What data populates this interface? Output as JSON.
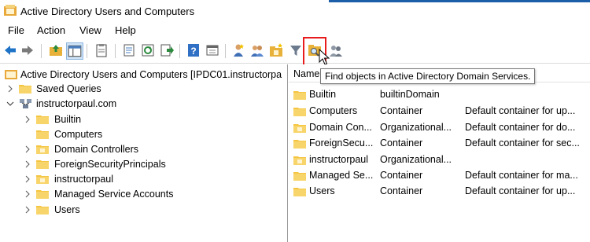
{
  "window": {
    "title": "Active Directory Users and Computers"
  },
  "menu": [
    "File",
    "Action",
    "View",
    "Help"
  ],
  "tooltip": "Find objects in Active Directory Domain Services.",
  "tree": {
    "root": "Active Directory Users and Computers [IPDC01.instructorpa",
    "saved_queries": "Saved Queries",
    "domain": "instructorpaul.com",
    "children": [
      "Builtin",
      "Computers",
      "Domain Controllers",
      "ForeignSecurityPrincipals",
      "instructorpaul",
      "Managed Service Accounts",
      "Users"
    ]
  },
  "list": {
    "header_name": "Name",
    "rows": [
      {
        "name": "Builtin",
        "type": "builtinDomain",
        "desc": ""
      },
      {
        "name": "Computers",
        "type": "Container",
        "desc": "Default container for up..."
      },
      {
        "name": "Domain Con...",
        "type": "Organizational...",
        "desc": "Default container for do..."
      },
      {
        "name": "ForeignSecu...",
        "type": "Container",
        "desc": "Default container for sec..."
      },
      {
        "name": "instructorpaul",
        "type": "Organizational...",
        "desc": ""
      },
      {
        "name": "Managed Se...",
        "type": "Container",
        "desc": "Default container for ma..."
      },
      {
        "name": "Users",
        "type": "Container",
        "desc": "Default container for up..."
      }
    ]
  },
  "colors": {
    "highlight": "#e81c1c",
    "folder": "#f5c542",
    "accent": "#1c5fa8"
  },
  "icons": [
    "back-icon",
    "forward-icon",
    "up-folder-icon",
    "show-hide-tree-icon",
    "clipboard-icon",
    "properties-icon",
    "refresh-icon",
    "export-icon",
    "help-icon",
    "console-icon",
    "new-user-icon",
    "new-group-icon",
    "new-ou-icon",
    "filter-icon",
    "find-icon",
    "add-to-group-icon"
  ]
}
